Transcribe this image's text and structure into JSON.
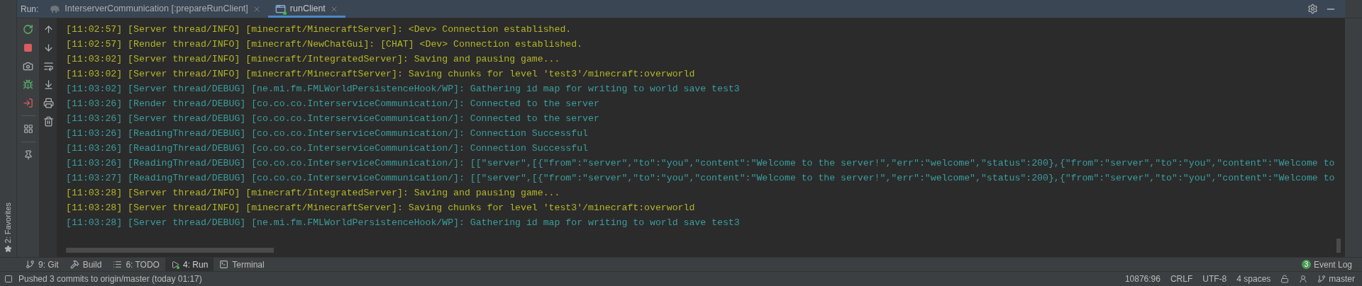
{
  "run_bar": {
    "label": "Run:",
    "tabs": [
      {
        "label": "InterserverCommunication [:prepareRunClient]",
        "kind": "gradle",
        "selected": false
      },
      {
        "label": "runClient",
        "kind": "app",
        "selected": true
      }
    ]
  },
  "favorites": {
    "label": "2: Favorites"
  },
  "console": {
    "lines": [
      {
        "kind": "info",
        "text": "[11:02:57] [Server thread/INFO] [minecraft/MinecraftServer]: <Dev> Connection established."
      },
      {
        "kind": "info",
        "text": "[11:02:57] [Render thread/INFO] [minecraft/NewChatGui]: [CHAT] <Dev> Connection established."
      },
      {
        "kind": "info",
        "text": "[11:03:02] [Server thread/INFO] [minecraft/IntegratedServer]: Saving and pausing game..."
      },
      {
        "kind": "info",
        "text": "[11:03:02] [Server thread/INFO] [minecraft/MinecraftServer]: Saving chunks for level 'test3'/minecraft:overworld"
      },
      {
        "kind": "debug",
        "text": "[11:03:02] [Server thread/DEBUG] [ne.mi.fm.FMLWorldPersistenceHook/WP]: Gathering id map for writing to world save test3"
      },
      {
        "kind": "debug",
        "text": "[11:03:26] [Render thread/DEBUG] [co.co.co.InterserviceCommunication/]: Connected to the server"
      },
      {
        "kind": "debug",
        "text": "[11:03:26] [Server thread/DEBUG] [co.co.co.InterserviceCommunication/]: Connected to the server"
      },
      {
        "kind": "debug",
        "text": "[11:03:26] [ReadingThread/DEBUG] [co.co.co.InterserviceCommunication/]: Connection Successful"
      },
      {
        "kind": "debug",
        "text": "[11:03:26] [ReadingThread/DEBUG] [co.co.co.InterserviceCommunication/]: Connection Successful"
      },
      {
        "kind": "debug",
        "text": "[11:03:26] [ReadingThread/DEBUG] [co.co.co.InterserviceCommunication/]: [[\"server\",[{\"from\":\"server\",\"to\":\"you\",\"content\":\"Welcome to the server!\",\"err\":\"welcome\",\"status\":200},{\"from\":\"server\",\"to\":\"you\",\"content\":\"Welcome to"
      },
      {
        "kind": "debug",
        "text": "[11:03:27] [ReadingThread/DEBUG] [co.co.co.InterserviceCommunication/]: [[\"server\",[{\"from\":\"server\",\"to\":\"you\",\"content\":\"Welcome to the server!\",\"err\":\"welcome\",\"status\":200},{\"from\":\"server\",\"to\":\"you\",\"content\":\"Welcome to"
      },
      {
        "kind": "info",
        "text": "[11:03:28] [Server thread/INFO] [minecraft/IntegratedServer]: Saving and pausing game..."
      },
      {
        "kind": "info",
        "text": "[11:03:28] [Server thread/INFO] [minecraft/MinecraftServer]: Saving chunks for level 'test3'/minecraft:overworld"
      },
      {
        "kind": "debug",
        "text": "[11:03:28] [Server thread/DEBUG] [ne.mi.fm.FMLWorldPersistenceHook/WP]: Gathering id map for writing to world save test3"
      }
    ]
  },
  "tool_windows": [
    {
      "label": "9: Git",
      "kind": "git",
      "selected": false
    },
    {
      "label": "Build",
      "kind": "build",
      "selected": false
    },
    {
      "label": "6: TODO",
      "kind": "todo",
      "selected": false
    },
    {
      "label": "4: Run",
      "kind": "run",
      "selected": true
    },
    {
      "label": "Terminal",
      "kind": "terminal",
      "selected": false
    }
  ],
  "event_log": {
    "count": "3",
    "label": "Event Log"
  },
  "status_bar": {
    "message": "Pushed 3 commits to origin/master (today 01:17)",
    "position": "10876:96",
    "line_separator": "CRLF",
    "encoding": "UTF-8",
    "indent": "4 spaces",
    "branch": "master"
  }
}
